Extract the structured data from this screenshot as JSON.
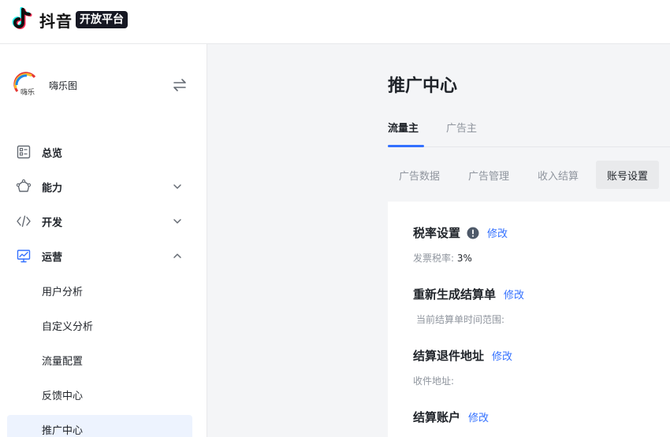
{
  "brand": {
    "name": "抖音",
    "badge": "开放平台"
  },
  "app": {
    "name": "嗨乐图"
  },
  "nav": {
    "items": [
      {
        "label": "总览"
      },
      {
        "label": "能力"
      },
      {
        "label": "开发"
      },
      {
        "label": "运营"
      }
    ],
    "sub_items": [
      {
        "label": "用户分析"
      },
      {
        "label": "自定义分析"
      },
      {
        "label": "流量配置"
      },
      {
        "label": "反馈中心"
      },
      {
        "label": "推广中心"
      }
    ]
  },
  "main": {
    "title": "推广中心",
    "tabs": [
      {
        "label": "流量主"
      },
      {
        "label": "广告主"
      }
    ],
    "subtabs": [
      {
        "label": "广告数据"
      },
      {
        "label": "广告管理"
      },
      {
        "label": "收入结算"
      },
      {
        "label": "账号设置"
      }
    ],
    "sections": [
      {
        "title": "税率设置",
        "edit": "修改",
        "desc_label": "发票税率:",
        "desc_value": "3%"
      },
      {
        "title": "重新生成结算单",
        "edit": "修改",
        "desc_label": "当前结算单时间范围:"
      },
      {
        "title": "结算退件地址",
        "edit": "修改",
        "desc_label": "收件地址:"
      },
      {
        "title": "结算账户",
        "edit": "修改"
      }
    ]
  },
  "colors": {
    "accent": "#3370ff",
    "active_bg": "#edf3fe",
    "brand_cyan": "#25f4ee",
    "brand_red": "#fe2c55"
  }
}
